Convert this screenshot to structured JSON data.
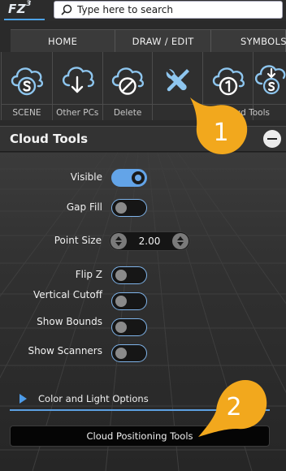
{
  "app": {
    "logo_text": "FZ",
    "logo_sup": "3"
  },
  "search": {
    "placeholder": "Type here to search"
  },
  "tabs": [
    {
      "label": "HOME"
    },
    {
      "label": "DRAW / EDIT"
    },
    {
      "label": "SYMBOLS"
    }
  ],
  "ribbon": {
    "buttons": [
      {
        "label": "SCENE",
        "icon": "cloud-s-icon"
      },
      {
        "label": "Other PCs",
        "icon": "cloud-download-icon"
      },
      {
        "label": "Delete",
        "icon": "cloud-delete-icon"
      },
      {
        "label": "",
        "icon": "tools-icon"
      },
      {
        "label": "",
        "icon": "cloud-one-icon"
      },
      {
        "label": "",
        "icon": "cloud-s-download-icon"
      }
    ],
    "group_label": "Cloud Tools"
  },
  "panel": {
    "title": "Cloud Tools",
    "toggles": [
      {
        "label": "Visible",
        "state": "on"
      },
      {
        "label": "Gap Fill",
        "state": "off"
      },
      {
        "label": "Flip Z",
        "state": "off"
      },
      {
        "label": "Vertical Cutoff",
        "state": "off"
      },
      {
        "label": "Show Bounds",
        "state": "off"
      },
      {
        "label": "Show Scanners",
        "state": "off"
      }
    ],
    "point_size": {
      "label": "Point Size",
      "value": "2.00"
    },
    "color_options_label": "Color and Light Options",
    "positioning_button_label": "Cloud Positioning Tools"
  },
  "callouts": [
    {
      "number": "1"
    },
    {
      "number": "2"
    }
  ],
  "colors": {
    "accent": "#63a4e8",
    "callout": "#f2a81d",
    "icon_blue": "#8ec6ef"
  }
}
